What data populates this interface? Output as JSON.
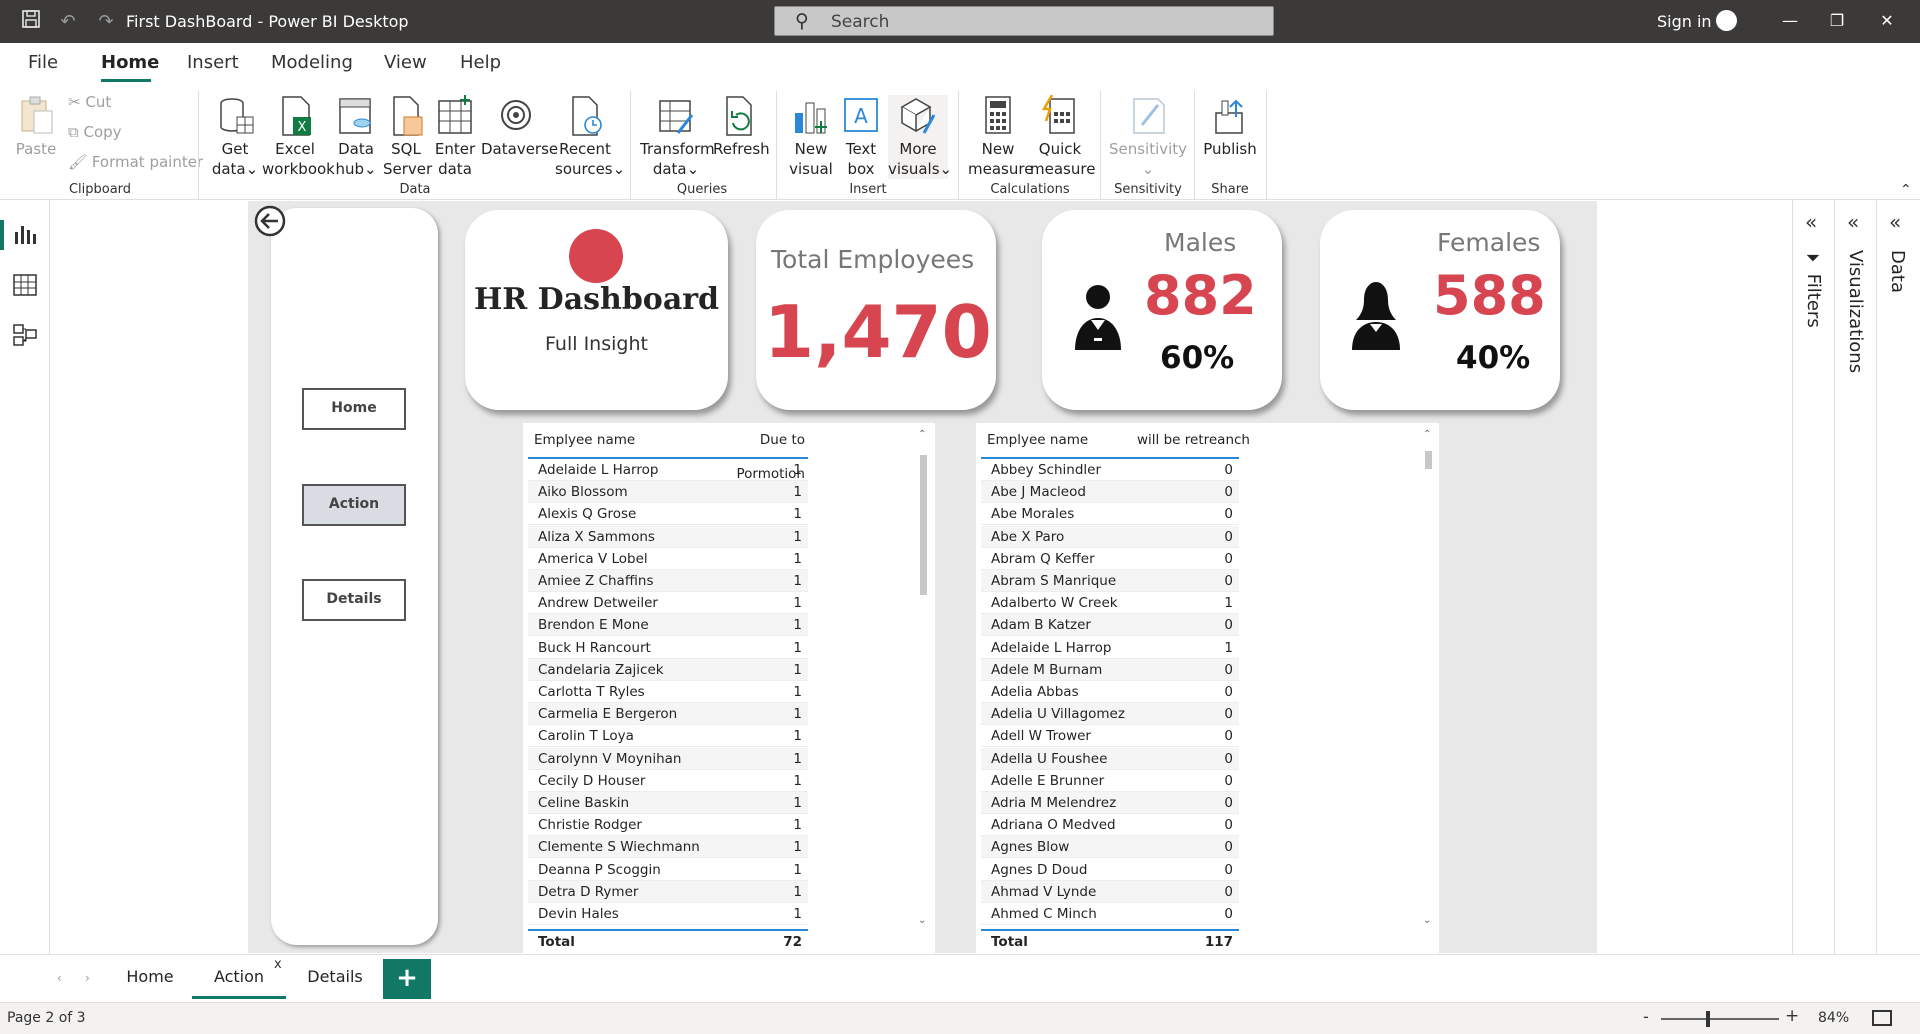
{
  "window": {
    "title": "First DashBoard - Power BI Desktop",
    "search_placeholder": "Search",
    "signin": "Sign in"
  },
  "menu": {
    "items": [
      "File",
      "Home",
      "Insert",
      "Modeling",
      "View",
      "Help"
    ],
    "active": "Home"
  },
  "ribbon": {
    "clipboard": {
      "paste": "Paste",
      "cut": "Cut",
      "copy": "Copy",
      "format_painter": "Format painter",
      "group": "Clipboard"
    },
    "data": {
      "get_data": [
        "Get",
        "data"
      ],
      "excel": [
        "Excel",
        "workbook"
      ],
      "data_hub": [
        "Data",
        "hub"
      ],
      "sql": [
        "SQL",
        "Server"
      ],
      "enter": [
        "Enter",
        "data"
      ],
      "dataverse": [
        "Dataverse"
      ],
      "recent": [
        "Recent",
        "sources"
      ],
      "group": "Data"
    },
    "queries": {
      "transform": [
        "Transform",
        "data"
      ],
      "refresh": [
        "Refresh"
      ],
      "group": "Queries"
    },
    "insert": {
      "new_visual": [
        "New",
        "visual"
      ],
      "text_box": [
        "Text",
        "box"
      ],
      "more_visuals": [
        "More",
        "visuals"
      ],
      "group": "Insert"
    },
    "calculations": {
      "new_measure": [
        "New",
        "measure"
      ],
      "quick_measure": [
        "Quick",
        "measure"
      ],
      "group": "Calculations"
    },
    "sensitivity": {
      "label": "Sensitivity",
      "group": "Sensitivity"
    },
    "share": {
      "publish": "Publish",
      "group": "Share"
    }
  },
  "nav": {
    "home": "Home",
    "action": "Action",
    "details": "Details"
  },
  "cards": {
    "hr_title": "HR Dashboard",
    "hr_subtitle": "Full Insight",
    "total_label": "Total Employees",
    "total_value": "1,470",
    "males_label": "Males",
    "males_value": "882",
    "males_pct": "60%",
    "females_label": "Females",
    "females_value": "588",
    "females_pct": "40%"
  },
  "colors": {
    "accent_red": "#d64550",
    "powerbi_green": "#117865",
    "table_line": "#2b88d8"
  },
  "table_promotion": {
    "col1": "Emplyee name",
    "col2": "Due to Pormotion",
    "rows": [
      [
        "Adelaide L Harrop",
        "1"
      ],
      [
        "Aiko Blossom",
        "1"
      ],
      [
        "Alexis Q Grose",
        "1"
      ],
      [
        "Aliza X Sammons",
        "1"
      ],
      [
        "America V Lobel",
        "1"
      ],
      [
        "Amiee Z Chaffins",
        "1"
      ],
      [
        "Andrew Detweiler",
        "1"
      ],
      [
        "Brendon E Mone",
        "1"
      ],
      [
        "Buck H Rancourt",
        "1"
      ],
      [
        "Candelaria Zajicek",
        "1"
      ],
      [
        "Carlotta T Ryles",
        "1"
      ],
      [
        "Carmelia E Bergeron",
        "1"
      ],
      [
        "Carolin T Loya",
        "1"
      ],
      [
        "Carolynn V Moynihan",
        "1"
      ],
      [
        "Cecily D Houser",
        "1"
      ],
      [
        "Celine Baskin",
        "1"
      ],
      [
        "Christie Rodger",
        "1"
      ],
      [
        "Clemente S Wiechmann",
        "1"
      ],
      [
        "Deanna P Scoggin",
        "1"
      ],
      [
        "Detra D Rymer",
        "1"
      ],
      [
        "Devin Hales",
        "1"
      ]
    ],
    "total_label": "Total",
    "total_value": "72"
  },
  "table_retrench": {
    "col1": "Emplyee name",
    "col2": "will be retreanch",
    "rows": [
      [
        "Abbey Schindler",
        "0"
      ],
      [
        "Abe J Macleod",
        "0"
      ],
      [
        "Abe Morales",
        "0"
      ],
      [
        "Abe X Paro",
        "0"
      ],
      [
        "Abram Q Keffer",
        "0"
      ],
      [
        "Abram S Manrique",
        "0"
      ],
      [
        "Adalberto W Creek",
        "1"
      ],
      [
        "Adam B Katzer",
        "0"
      ],
      [
        "Adelaide L Harrop",
        "1"
      ],
      [
        "Adele M Burnam",
        "0"
      ],
      [
        "Adelia Abbas",
        "0"
      ],
      [
        "Adelia U Villagomez",
        "0"
      ],
      [
        "Adell W Trower",
        "0"
      ],
      [
        "Adella U Foushee",
        "0"
      ],
      [
        "Adelle E Brunner",
        "0"
      ],
      [
        "Adria M Melendrez",
        "0"
      ],
      [
        "Adriana O Medved",
        "0"
      ],
      [
        "Agnes Blow",
        "0"
      ],
      [
        "Agnes D Doud",
        "0"
      ],
      [
        "Ahmad V Lynde",
        "0"
      ],
      [
        "Ahmed C Minch",
        "0"
      ]
    ],
    "total_label": "Total",
    "total_value": "117"
  },
  "panes": {
    "filters": "Filters",
    "visualizations": "Visualizations",
    "data": "Data"
  },
  "tabs": {
    "items": [
      "Home",
      "Action",
      "Details"
    ],
    "active": "Action",
    "add": "+",
    "close": "x"
  },
  "status": {
    "page": "Page 2 of 3",
    "zoom": "84%",
    "zoom_level": 84
  }
}
